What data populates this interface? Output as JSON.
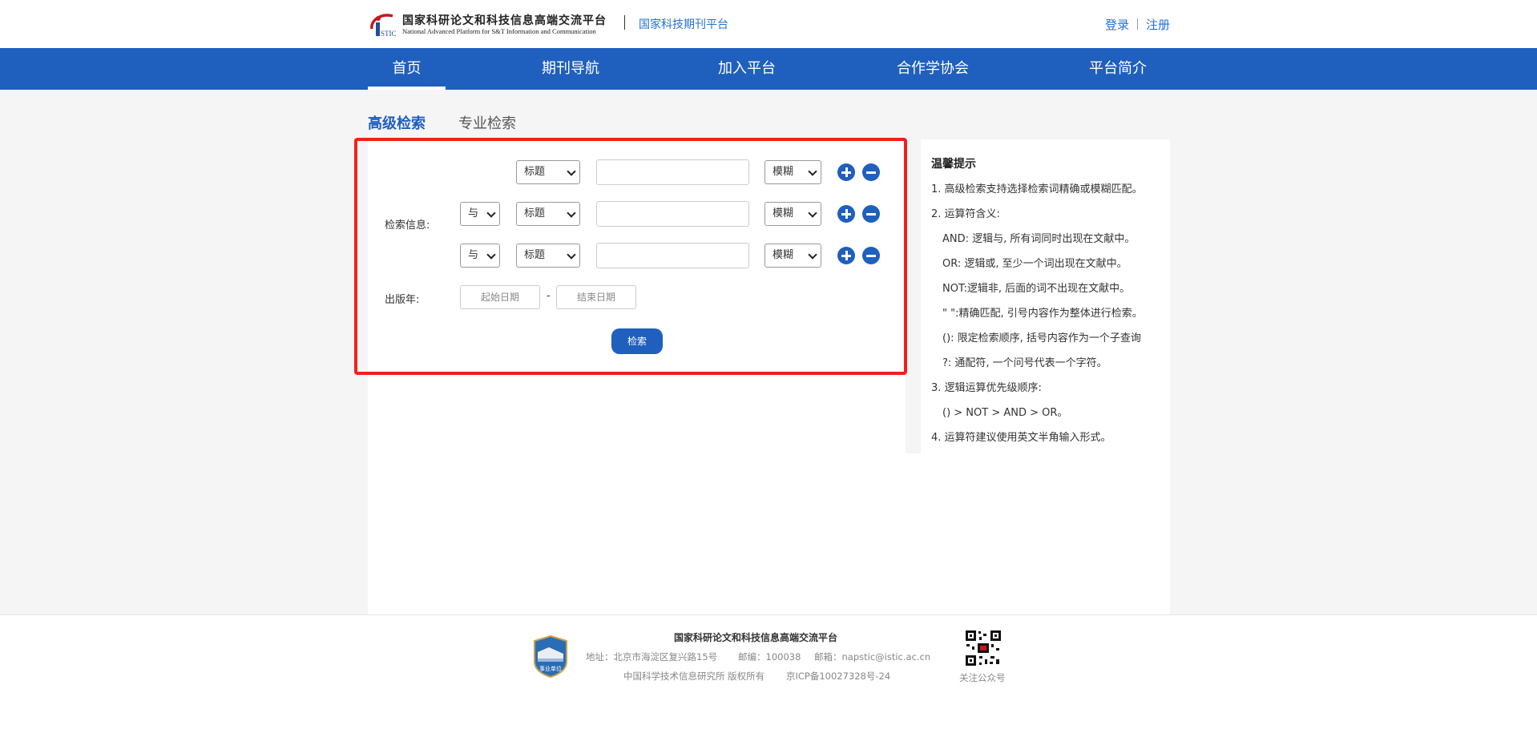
{
  "header": {
    "logo_cn": "国家科研论文和科技信息高端交流平台",
    "logo_en": "National Advanced Platform for S&T Information and Communication",
    "logo_mark_text": "STIC",
    "platform_name": "国家科技期刊平台",
    "login_label": "登录",
    "register_label": "注册"
  },
  "nav": {
    "items": [
      "首页",
      "期刊导航",
      "加入平台",
      "合作学协会",
      "平台简介"
    ],
    "active_index": 0
  },
  "tabs": {
    "advanced": "高级检索",
    "professional": "专业检索"
  },
  "form": {
    "search_info_label": "检索信息:",
    "pub_year_label": "出版年:",
    "rows": [
      {
        "logic": "",
        "field": "标题",
        "match": "模糊",
        "value": ""
      },
      {
        "logic": "与",
        "field": "标题",
        "match": "模糊",
        "value": ""
      },
      {
        "logic": "与",
        "field": "标题",
        "match": "模糊",
        "value": ""
      }
    ],
    "start_date_placeholder": "起始日期",
    "end_date_placeholder": "结束日期",
    "date_separator": "-",
    "search_button": "检索"
  },
  "tips": {
    "title": "温馨提示",
    "lines": [
      "1. 高级检索支持选择检索词精确或模糊匹配。",
      "2. 运算符含义:",
      "AND: 逻辑与, 所有词同时出现在文献中。",
      "OR: 逻辑或, 至少一个词出现在文献中。",
      "NOT:逻辑非, 后面的词不出现在文献中。",
      "\" \":精确匹配, 引号内容作为整体进行检索。",
      "(): 限定检索顺序, 括号内容作为一个子查询",
      "?: 通配符, 一个问号代表一个字符。",
      "3. 逻辑运算优先级顺序:",
      "() > NOT > AND > OR。",
      "4. 运算符建议使用英文半角输入形式。"
    ]
  },
  "footer": {
    "title": "国家科研论文和科技信息高端交流平台",
    "address": "地址：北京市海淀区复兴路15号",
    "postcode": "邮编：100038",
    "email": "邮箱：napstic@istic.ac.cn",
    "copyright": "中国科学技术信息研究所 版权所有",
    "icp": "京ICP备10027328号-24",
    "badge_text": "事业单位",
    "qr_label": "关注公众号"
  },
  "colors": {
    "primary": "#1f5fbe",
    "link": "#2470d8",
    "highlight": "#f0201b"
  }
}
